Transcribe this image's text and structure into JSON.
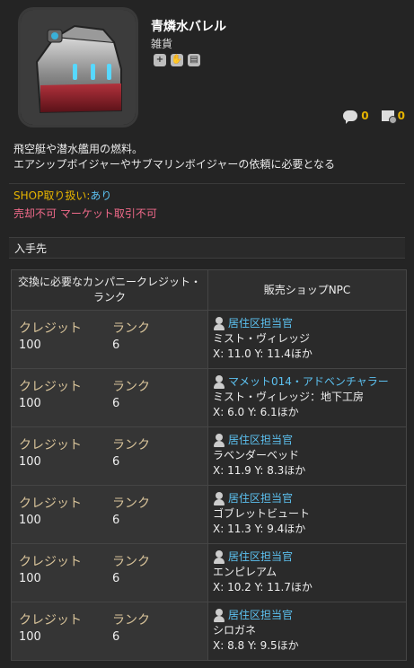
{
  "item": {
    "name": "青燐水バレル",
    "category": "雑貨",
    "icon": "fuel-canister-icon",
    "traits": [
      "plus-icon",
      "hand-icon",
      "shop-icon"
    ]
  },
  "counters": [
    {
      "icon": "comment-icon",
      "value": "0"
    },
    {
      "icon": "screenshot-icon",
      "value": "0"
    }
  ],
  "description": [
    "飛空艇や潜水艦用の燃料。",
    "エアシップボイジャーやサブマリンボイジャーの依頼に必要となる"
  ],
  "shop": {
    "label": "SHOP取り扱い:",
    "value": "あり"
  },
  "restrictions": "売却不可 マーケット取引不可",
  "section_title": "入手先",
  "table": {
    "headers": [
      "交換に必要なカンパニークレジット・ランク",
      "販売ショップNPC"
    ],
    "rows": [
      {
        "credit_label": "クレジット",
        "credit": "100",
        "rank_label": "ランク",
        "rank": "6",
        "npc": "居住区担当官",
        "location": "ミスト・ヴィレッジ",
        "coord": "X: 11.0 Y: 11.4ほか"
      },
      {
        "credit_label": "クレジット",
        "credit": "100",
        "rank_label": "ランク",
        "rank": "6",
        "npc": "マメット014・アドベンチャラー",
        "location": "ミスト・ヴィレッジ：地下工房",
        "coord": "X: 6.0 Y: 6.1ほか"
      },
      {
        "credit_label": "クレジット",
        "credit": "100",
        "rank_label": "ランク",
        "rank": "6",
        "npc": "居住区担当官",
        "location": "ラベンダーベッド",
        "coord": "X: 11.9 Y: 8.3ほか"
      },
      {
        "credit_label": "クレジット",
        "credit": "100",
        "rank_label": "ランク",
        "rank": "6",
        "npc": "居住区担当官",
        "location": "ゴブレットビュート",
        "coord": "X: 11.3 Y: 9.4ほか"
      },
      {
        "credit_label": "クレジット",
        "credit": "100",
        "rank_label": "ランク",
        "rank": "6",
        "npc": "居住区担当官",
        "location": "エンピレアム",
        "coord": "X: 10.2 Y: 11.7ほか"
      },
      {
        "credit_label": "クレジット",
        "credit": "100",
        "rank_label": "ランク",
        "rank": "6",
        "npc": "居住区担当官",
        "location": "シロガネ",
        "coord": "X: 8.8 Y: 9.5ほか"
      }
    ]
  }
}
